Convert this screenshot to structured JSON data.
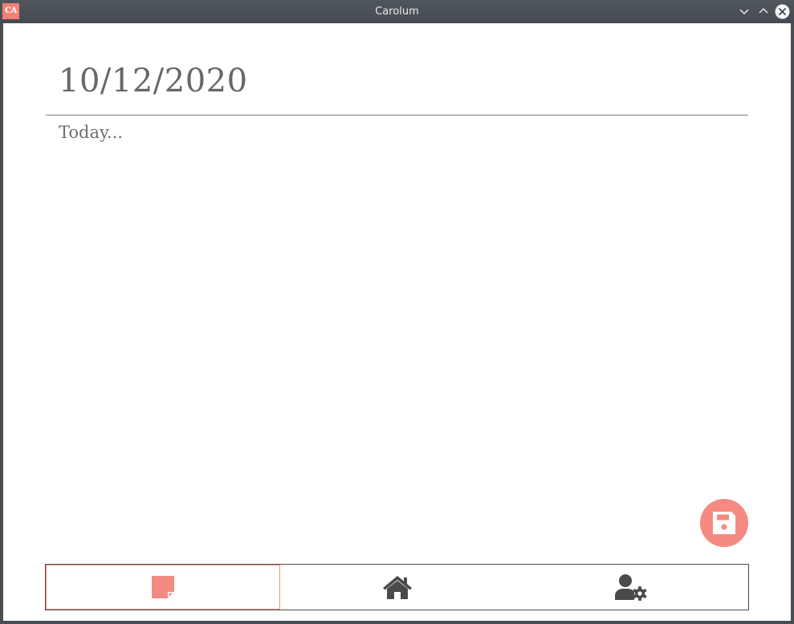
{
  "window": {
    "title": "Carolum",
    "logo_text": "CA",
    "controls": [
      "minimize",
      "maximize",
      "close"
    ]
  },
  "entry": {
    "date": "10/12/2020",
    "placeholder": "Today..."
  },
  "colors": {
    "accent": "#f58a82",
    "text": "#676767",
    "icon_dark": "#4a4a4a"
  },
  "bottom_nav": {
    "tabs": [
      {
        "id": "entry",
        "icon": "note-icon",
        "active": true
      },
      {
        "id": "home",
        "icon": "home-icon",
        "active": false
      },
      {
        "id": "account-settings",
        "icon": "user-settings-icon",
        "active": false
      }
    ]
  },
  "actions": {
    "save_icon": "floppy-disk-icon"
  }
}
